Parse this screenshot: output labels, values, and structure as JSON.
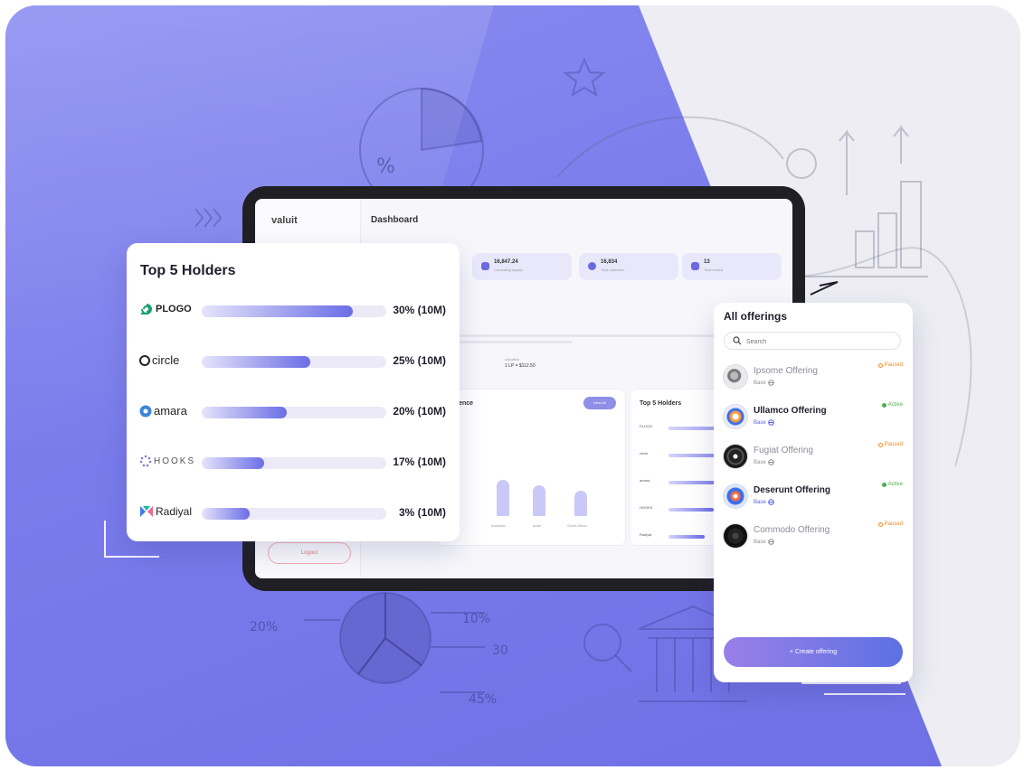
{
  "dashboard": {
    "brand": "valuit",
    "title": "Dashboard",
    "logout_label": "Logout",
    "stats": [
      {
        "value": "16,847.24",
        "label": "Circulating supply"
      },
      {
        "value": "16,834",
        "label": "Total unlocked"
      },
      {
        "value": "13",
        "label": "Total locked"
      }
    ],
    "valuation_label": "Valuation",
    "valuation_value": "1 LP = $112.50",
    "residence_title": "sidence",
    "view_all_label": "View All",
    "countries": [
      "Australia",
      "India",
      "South Africa"
    ],
    "top_holders_title": "Top 5 Holders",
    "top_holders_mini": [
      "PLOGO",
      "circle",
      "amara",
      "HOOKS",
      "Radiyal"
    ]
  },
  "holders_card": {
    "title": "Top 5 Holders",
    "rows": [
      {
        "name": "PLOGO",
        "share": 0.82,
        "pct": "30% (10M)",
        "icon": "plogo-logo-icon",
        "color": "#1aa36d"
      },
      {
        "name": "circle",
        "share": 0.59,
        "pct": "25% (10M)",
        "icon": "circle-logo-icon",
        "color": "#222222"
      },
      {
        "name": "amara",
        "share": 0.46,
        "pct": "20% (10M)",
        "icon": "amara-logo-icon",
        "color": "#3b86d8"
      },
      {
        "name": "HOOKS",
        "share": 0.34,
        "pct": "17% (10M)",
        "icon": "hooks-logo-icon",
        "color": "#7c7cd8"
      },
      {
        "name": "Radiyal",
        "share": 0.26,
        "pct": "3% (10M)",
        "icon": "radiyal-logo-icon",
        "color": "#3f7ef0"
      }
    ]
  },
  "offerings": {
    "title": "All offerings",
    "search_placeholder": "Search",
    "items": [
      {
        "name": "Ipsome Offering",
        "network": "Base",
        "status": "Paused",
        "state": "muted"
      },
      {
        "name": "Ullamco Offering",
        "network": "Base",
        "status": "Active",
        "state": "strong"
      },
      {
        "name": "Fugiat Offering",
        "network": "Base",
        "status": "Paused",
        "state": "muted"
      },
      {
        "name": "Deserunt Offering",
        "network": "Base",
        "status": "Active",
        "state": "strong"
      },
      {
        "name": "Commodo Offering",
        "network": "Base",
        "status": "Paused",
        "state": "muted"
      }
    ],
    "create_label": "+ Create offering"
  },
  "background_doodles": {
    "labels": [
      "%",
      "10%",
      "20%",
      "30",
      "45%"
    ]
  },
  "colors": {
    "accent": "#6a6ee6",
    "active": "#4caf50",
    "paused": "#f08a24"
  }
}
